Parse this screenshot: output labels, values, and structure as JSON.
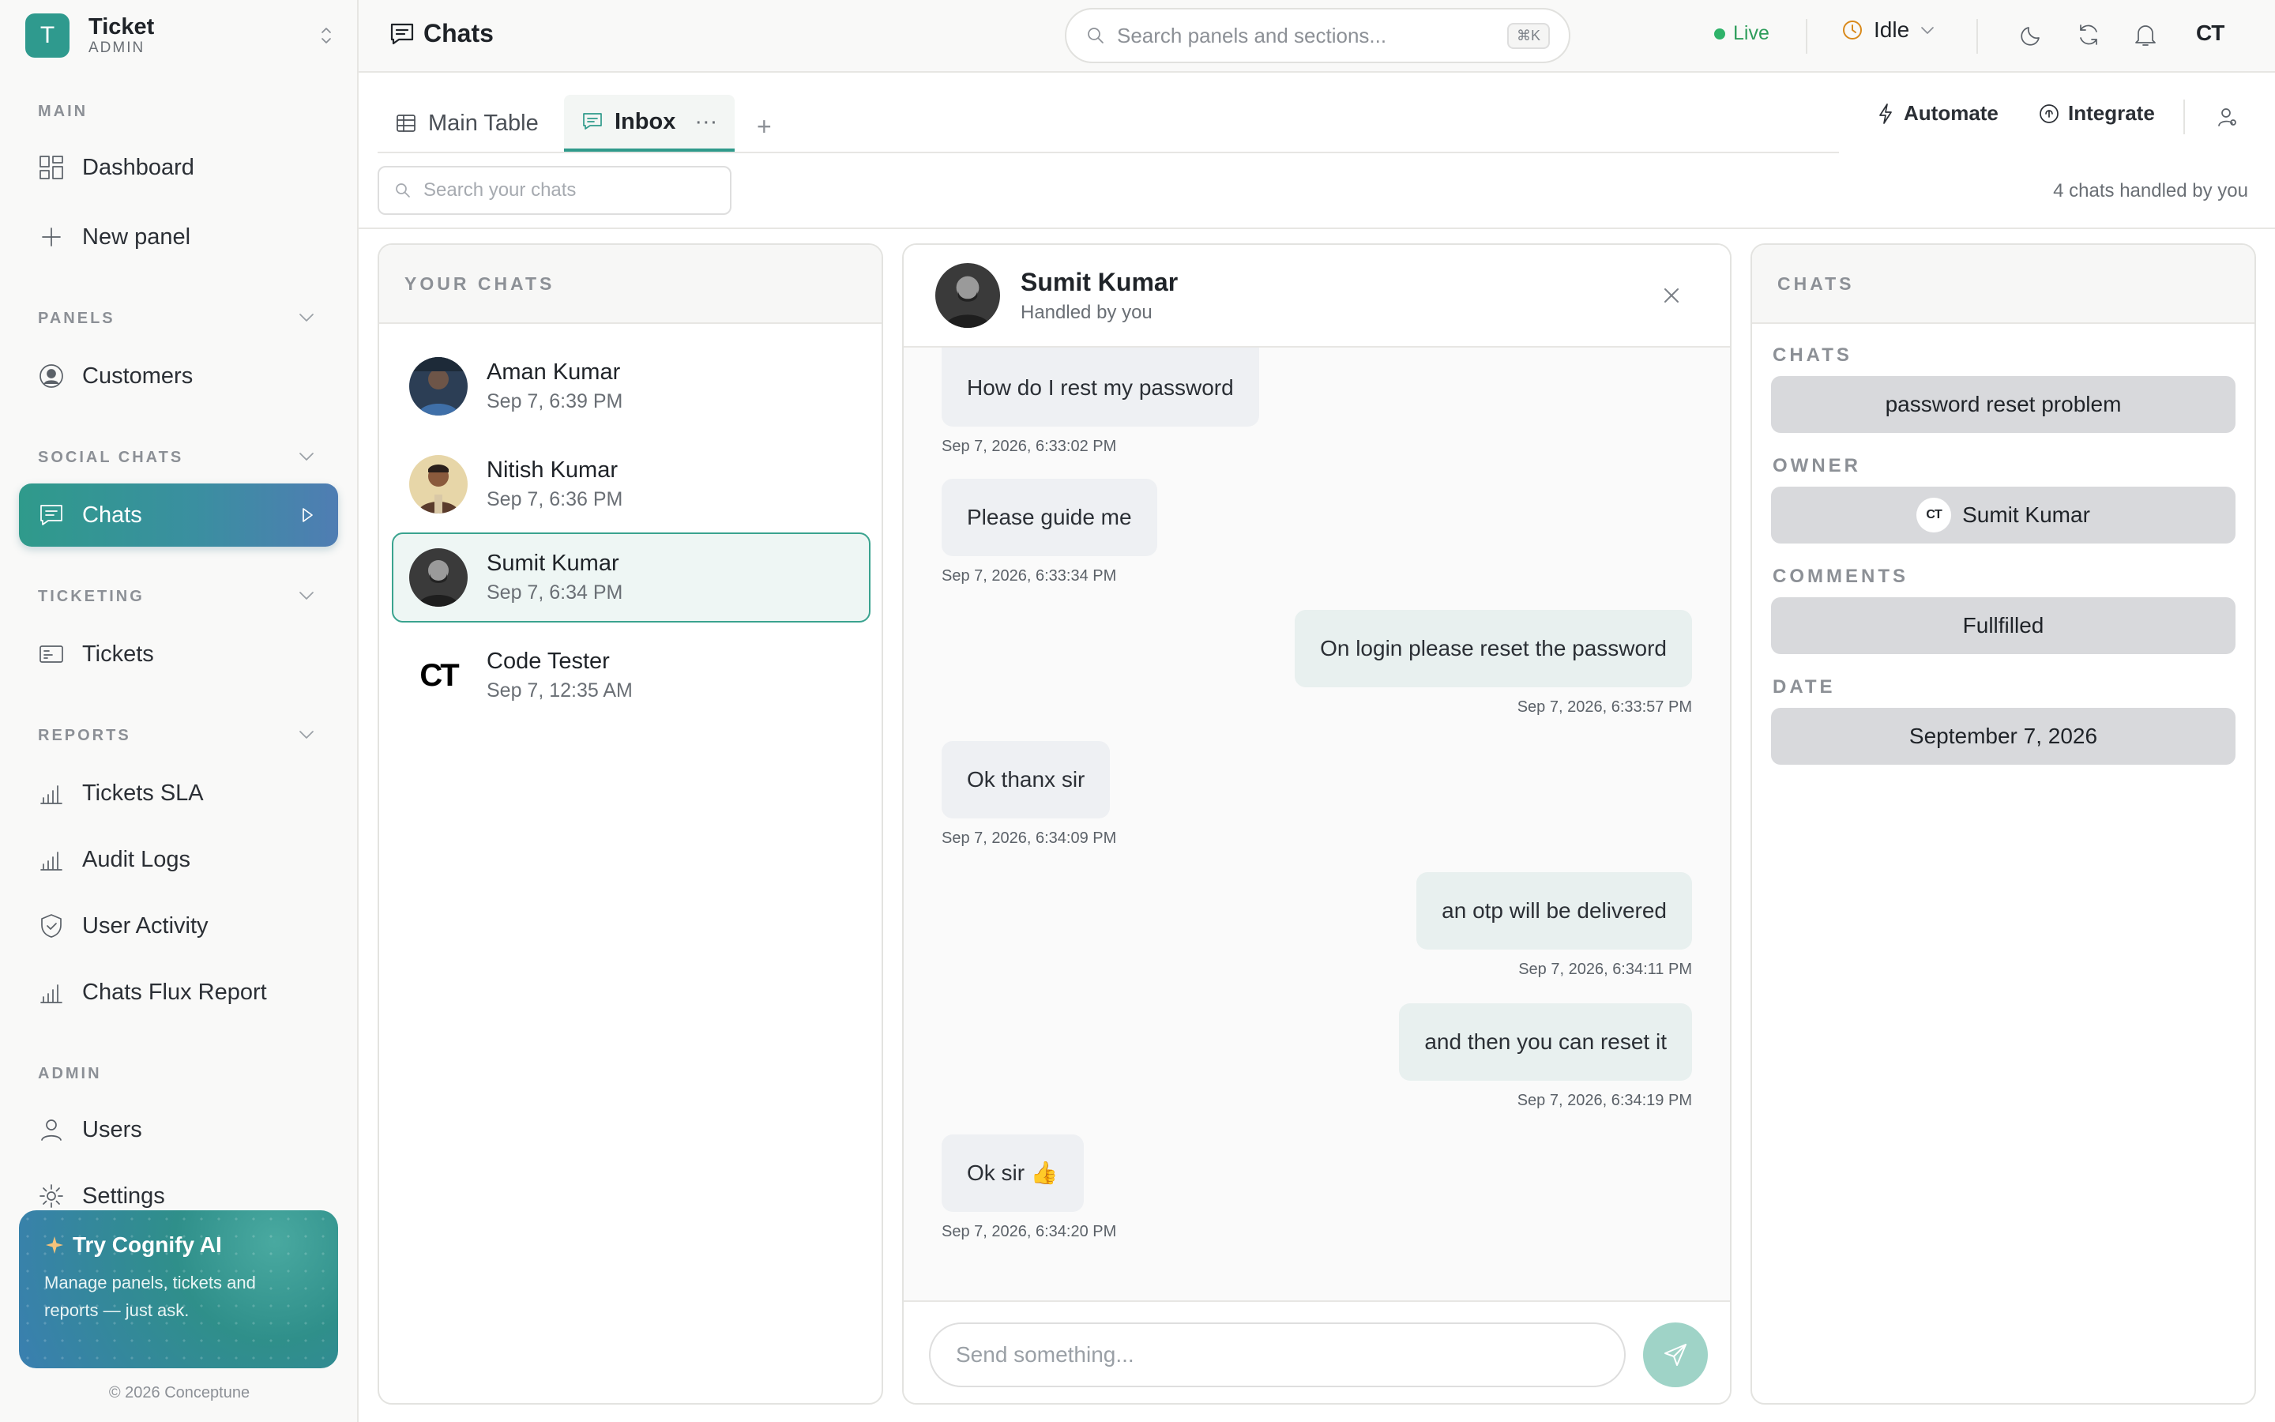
{
  "brand": {
    "logo_letter": "T",
    "name": "Ticket",
    "role": "ADMIN"
  },
  "sidebar": {
    "sections": {
      "main": "MAIN",
      "panels": "PANELS",
      "social": "SOCIAL CHATS",
      "ticketing": "TICKETING",
      "reports": "REPORTS",
      "admin": "ADMIN"
    },
    "items": {
      "dashboard": "Dashboard",
      "new_panel": "New panel",
      "customers": "Customers",
      "chats": "Chats",
      "tickets": "Tickets",
      "tickets_sla": "Tickets SLA",
      "audit_logs": "Audit Logs",
      "user_activity": "User Activity",
      "chats_flux": "Chats Flux Report",
      "users": "Users",
      "settings": "Settings"
    },
    "promo": {
      "title": "Try Cognify AI",
      "text": "Manage panels, tickets and reports — just ask."
    },
    "copyright": "© 2026 Conceptune"
  },
  "header": {
    "title": "Chats",
    "search_placeholder": "Search panels and sections...",
    "search_shortcut": "⌘K",
    "live_label": "Live",
    "status": "Idle",
    "user_initials": "CT"
  },
  "tabs": [
    {
      "label": "Main Table"
    },
    {
      "label": "Inbox",
      "more": "···"
    }
  ],
  "toolbar": {
    "add_tab": "+",
    "automate": "Automate",
    "integrate": "Integrate"
  },
  "chat_search_placeholder": "Search your chats",
  "handled_count": "4 chats handled by you",
  "chat_list": {
    "title": "YOUR CHATS",
    "items": [
      {
        "name": "Aman Kumar",
        "time": "Sep 7, 6:39 PM"
      },
      {
        "name": "Nitish Kumar",
        "time": "Sep 7, 6:36 PM"
      },
      {
        "name": "Sumit Kumar",
        "time": "Sep 7, 6:34 PM"
      },
      {
        "name": "Code Tester",
        "time": "Sep 7, 12:35 AM",
        "initials": "CT"
      }
    ]
  },
  "conversation": {
    "name": "Sumit Kumar",
    "subtitle": "Handled by you",
    "messages": [
      {
        "text": "How do I rest my password",
        "time": "Sep 7, 2026, 6:33:02 PM",
        "dir": "in"
      },
      {
        "text": "Please guide me",
        "time": "Sep 7, 2026, 6:33:34 PM",
        "dir": "in"
      },
      {
        "text": "On login please reset the password",
        "time": "Sep 7, 2026, 6:33:57 PM",
        "dir": "out"
      },
      {
        "text": "Ok thanx sir",
        "time": "Sep 7, 2026, 6:34:09 PM",
        "dir": "in"
      },
      {
        "text": "an otp will be delivered",
        "time": "Sep 7, 2026, 6:34:11 PM",
        "dir": "out"
      },
      {
        "text": "and then you can reset it",
        "time": "Sep 7, 2026, 6:34:19 PM",
        "dir": "out"
      },
      {
        "text": "Ok sir 👍",
        "time": "Sep 7, 2026, 6:34:20 PM",
        "dir": "in"
      }
    ],
    "input_placeholder": "Send something..."
  },
  "details": {
    "title": "CHATS",
    "fields": {
      "chats_label": "CHATS",
      "chats_value": "password reset problem",
      "owner_label": "OWNER",
      "owner_value": "Sumit Kumar",
      "owner_initials": "CT",
      "comments_label": "COMMENTS",
      "comments_value": "Fullfilled",
      "date_label": "DATE",
      "date_value": "September 7, 2026"
    }
  },
  "colors": {
    "accent": "#2f9a8b",
    "live": "#2fb36a",
    "selected_border": "#3aa38f"
  }
}
